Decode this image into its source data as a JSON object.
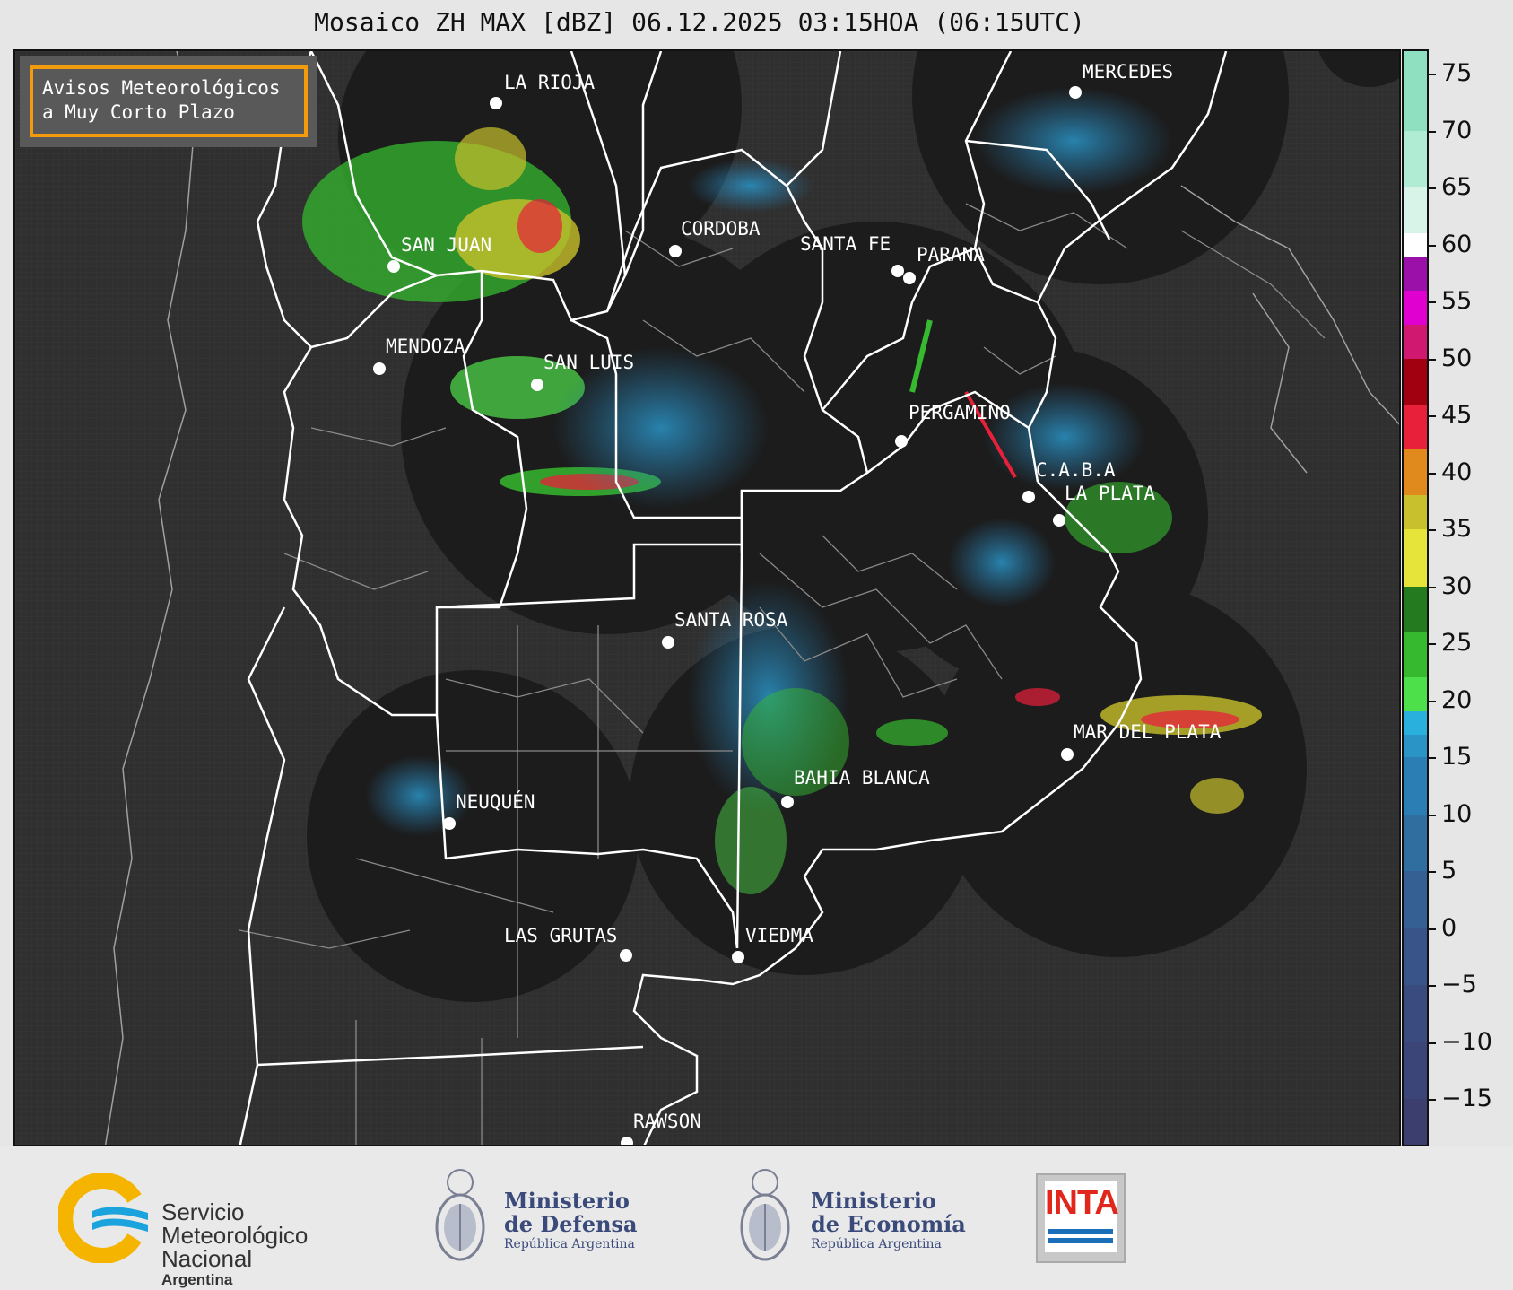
{
  "title": "Mosaico ZH MAX [dBZ] 06.12.2025 03:15HOA (06:15UTC)",
  "notice": {
    "line1": "Avisos Meteorológicos",
    "line2": "a Muy Corto Plazo"
  },
  "colors": {
    "map_background": "#2f2f2f",
    "radar_coverage": "#1c1c1c",
    "province_border": "#ffffff",
    "department_border": "#8a8a8a",
    "notice_border": "#f29b0c"
  },
  "cities": [
    {
      "name": "LA RIOJA"
    },
    {
      "name": "SAN JUAN"
    },
    {
      "name": "CORDOBA"
    },
    {
      "name": "SANTA FE"
    },
    {
      "name": "PARANA"
    },
    {
      "name": "MERCEDES"
    },
    {
      "name": "MENDOZA"
    },
    {
      "name": "SAN LUIS"
    },
    {
      "name": "PERGAMINO"
    },
    {
      "name": "C.A.B.A"
    },
    {
      "name": "LA PLATA"
    },
    {
      "name": "SANTA ROSA"
    },
    {
      "name": "MAR DEL PLATA"
    },
    {
      "name": "BAHIA BLANCA"
    },
    {
      "name": "NEUQUÉN"
    },
    {
      "name": "LAS GRUTAS"
    },
    {
      "name": "VIEDMA"
    },
    {
      "name": "RAWSON"
    }
  ],
  "colorbar": {
    "unit": "dBZ",
    "min": -19,
    "max": 77,
    "ticks": [
      "75",
      "70",
      "65",
      "60",
      "55",
      "50",
      "45",
      "40",
      "35",
      "30",
      "25",
      "20",
      "15",
      "10",
      "5",
      "0",
      "−5",
      "−10",
      "−15"
    ],
    "tick_values": [
      75,
      70,
      65,
      60,
      55,
      50,
      45,
      40,
      35,
      30,
      25,
      20,
      15,
      10,
      5,
      0,
      -5,
      -10,
      -15
    ],
    "bands": [
      {
        "from": -19,
        "to": -15,
        "color": "#3c3f6e"
      },
      {
        "from": -15,
        "to": -10,
        "color": "#3b4577"
      },
      {
        "from": -10,
        "to": -5,
        "color": "#3a4b80"
      },
      {
        "from": -5,
        "to": 0,
        "color": "#385489"
      },
      {
        "from": 0,
        "to": 5,
        "color": "#346093"
      },
      {
        "from": 5,
        "to": 10,
        "color": "#2f6e9f"
      },
      {
        "from": 10,
        "to": 15,
        "color": "#2a7eb3"
      },
      {
        "from": 15,
        "to": 17,
        "color": "#2a94c6"
      },
      {
        "from": 17,
        "to": 19,
        "color": "#2ab0dd"
      },
      {
        "from": 19,
        "to": 22,
        "color": "#4ee04a"
      },
      {
        "from": 22,
        "to": 26,
        "color": "#36b82f"
      },
      {
        "from": 26,
        "to": 30,
        "color": "#237a1f"
      },
      {
        "from": 30,
        "to": 35,
        "color": "#e6e43a"
      },
      {
        "from": 35,
        "to": 38,
        "color": "#c8c02c"
      },
      {
        "from": 38,
        "to": 42,
        "color": "#e08a1d"
      },
      {
        "from": 42,
        "to": 46,
        "color": "#e8203a"
      },
      {
        "from": 46,
        "to": 50,
        "color": "#a00010"
      },
      {
        "from": 50,
        "to": 53,
        "color": "#d01870"
      },
      {
        "from": 53,
        "to": 56,
        "color": "#e000d0"
      },
      {
        "from": 56,
        "to": 59,
        "color": "#9a10a8"
      },
      {
        "from": 59,
        "to": 61,
        "color": "#ffffff"
      },
      {
        "from": 61,
        "to": 65,
        "color": "#d8f4e8"
      },
      {
        "from": 65,
        "to": 70,
        "color": "#b0ecd4"
      },
      {
        "from": 70,
        "to": 77,
        "color": "#8ee0c0"
      }
    ]
  },
  "logos": {
    "smn": {
      "line1": "Servicio",
      "line2": "Meteorológico",
      "line3": "Nacional",
      "line4": "Argentina"
    },
    "defensa": {
      "line1": "Ministerio",
      "line2": "de Defensa",
      "line3": "República Argentina"
    },
    "economia": {
      "line1": "Ministerio",
      "line2": "de Economía",
      "line3": "República Argentina"
    },
    "inta": {
      "text": "INTA"
    }
  }
}
